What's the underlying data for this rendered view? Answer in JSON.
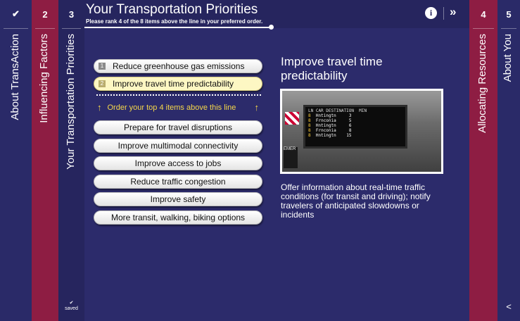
{
  "steps": [
    {
      "num": "✔",
      "label": "About TransAction"
    },
    {
      "num": "2",
      "label": "Influencing Factors"
    },
    {
      "num": "3",
      "label": "Your Transportation Priorities"
    },
    {
      "num": "4",
      "label": "Allocating Resources"
    },
    {
      "num": "5",
      "label": "About You"
    }
  ],
  "header": {
    "title": "Your Transportation Priorities",
    "subtitle": "Please rank 4 of the 8 items above the line in your preferred order.",
    "info_icon": "i",
    "next_icon": "»"
  },
  "ranked": [
    {
      "rank": "1",
      "label": "Reduce greenhouse gas emissions"
    },
    {
      "rank": "2",
      "label": "Improve travel time predictability"
    }
  ],
  "order_hint": "Order your top 4 items above this line",
  "unranked": [
    "Prepare for travel disruptions",
    "Improve multimodal connectivity",
    "Improve access to jobs",
    "Reduce traffic congestion",
    "Improve safety",
    "More transit, walking, biking options"
  ],
  "detail": {
    "title": "Improve travel time predictability",
    "description": "Offer information about real-time traffic conditions (for transit and driving); notify travelers of anticipated slowdowns or incidents"
  },
  "photo": {
    "header": "LN CAR DESTINATION  MIN",
    "rows": [
      {
        "ln": "8",
        "dest": "Hntingtn",
        "min": "3"
      },
      {
        "ln": "8",
        "dest": "Frnconia",
        "min": "5"
      },
      {
        "ln": "8",
        "dest": "Hntingtn",
        "min": "6"
      },
      {
        "ln": "8",
        "dest": "Frnconia",
        "min": "8"
      },
      {
        "ln": "8",
        "dest": "Hntingtn",
        "min": "15"
      }
    ],
    "side_text": "EMER"
  },
  "saved": {
    "icon": "✔",
    "label": "saved"
  },
  "share_icon": "<"
}
